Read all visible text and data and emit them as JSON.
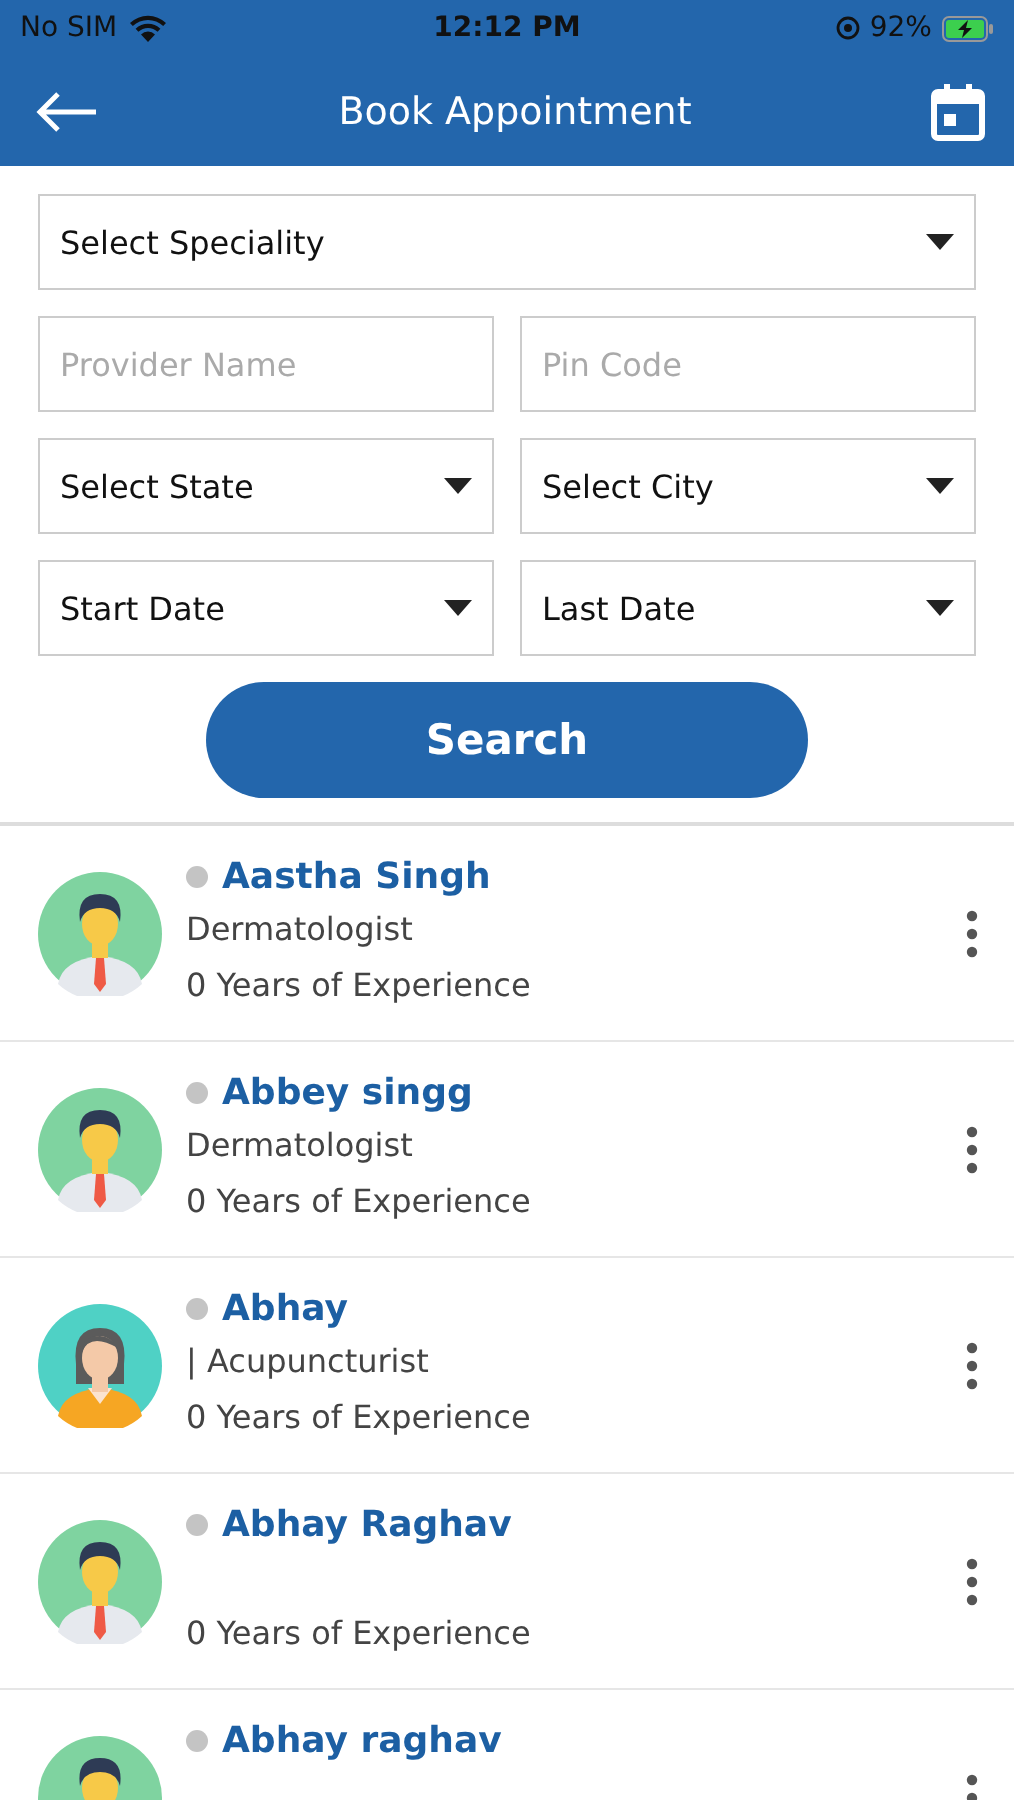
{
  "status_bar": {
    "carrier": "No SIM",
    "time": "12:12 PM",
    "battery": "92%"
  },
  "header": {
    "title": "Book Appointment"
  },
  "form": {
    "speciality": {
      "value": "Select Speciality"
    },
    "provider_name": {
      "placeholder": "Provider Name"
    },
    "pin_code": {
      "placeholder": "Pin Code"
    },
    "state": {
      "value": "Select State"
    },
    "city": {
      "value": "Select City"
    },
    "start_date": {
      "value": "Start Date"
    },
    "last_date": {
      "value": "Last Date"
    },
    "search_button": "Search"
  },
  "doctors": [
    {
      "name": "Aastha Singh",
      "speciality": "Dermatologist",
      "experience": "0 Years of Experience",
      "kind": "male",
      "online": false
    },
    {
      "name": "Abbey singg",
      "speciality": "Dermatologist",
      "experience": "0 Years of Experience",
      "kind": "male",
      "online": false
    },
    {
      "name": "Abhay",
      "speciality": "| Acupuncturist",
      "experience": "0 Years of Experience",
      "kind": "female",
      "online": false
    },
    {
      "name": "Abhay Raghav",
      "experience": "0 Years of Experience",
      "kind": "male",
      "online": false
    },
    {
      "name": "Abhay raghav",
      "kind": "male",
      "online": false
    }
  ]
}
